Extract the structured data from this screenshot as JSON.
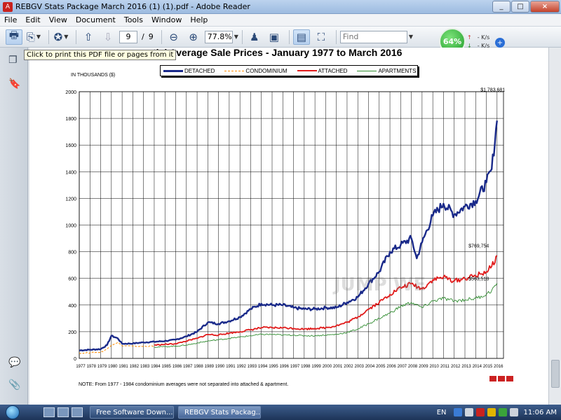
{
  "window": {
    "title": "REBGV Stats Package March 2016 (1) (1).pdf - Adobe Reader",
    "app_icon": "adobe-reader-icon",
    "controls": [
      "minimize",
      "maximize",
      "close"
    ]
  },
  "menu": [
    "File",
    "Edit",
    "View",
    "Document",
    "Tools",
    "Window",
    "Help"
  ],
  "toolbar": {
    "page_current": "9",
    "page_separator": "/",
    "page_total": "9",
    "zoom": "77.8%",
    "find_placeholder": "Find",
    "tooltip": "Click to print this PDF file or pages from it"
  },
  "speed_meter": {
    "percent": "64%",
    "up": "- K/s",
    "down": "- K/s"
  },
  "document": {
    "title": "...ential Average Sale Prices  -  January 1977 to March 2016",
    "ylabel": "IN THOUSANDS ($)",
    "note": "NOTE:  From 1977 - 1984 condominium averages were not separated into attached & apartment.",
    "watermark": "JUMP WE"
  },
  "chart_data": {
    "type": "line",
    "title": "Residential Average Sale Prices  -  January 1977 to March 2016",
    "ylabel": "IN THOUSANDS ($)",
    "ylim": [
      0,
      2000
    ],
    "yticks": [
      "0",
      "200",
      "400",
      "600",
      "800",
      "1000",
      "1200",
      "1400",
      "1600",
      "1800",
      "2000"
    ],
    "xticks": [
      "1977",
      "1978",
      "1979",
      "1980",
      "1981",
      "1982",
      "1983",
      "1984",
      "1985",
      "1986",
      "1987",
      "1988",
      "1989",
      "1990",
      "1991",
      "1992",
      "1993",
      "1994",
      "1995",
      "1996",
      "1997",
      "1998",
      "1999",
      "2000",
      "2001",
      "2002",
      "2003",
      "2004",
      "2005",
      "2006",
      "2007",
      "2008",
      "2009",
      "2010",
      "2011",
      "2012",
      "2013",
      "2014",
      "2015",
      "2016"
    ],
    "grid": true,
    "legend_position": "top",
    "series": [
      {
        "name": "DETACHED",
        "color": "#1a2a8a",
        "style": "solid",
        "x": [
          1977,
          1978,
          1979,
          1979.6,
          1980,
          1980.6,
          1981,
          1982,
          1983,
          1984,
          1985,
          1986,
          1987,
          1988,
          1989,
          1990,
          1991,
          1992,
          1993,
          1994,
          1995,
          1996,
          1997,
          1998,
          1999,
          2000,
          2001,
          2002,
          2003,
          2004,
          2005,
          2006,
          2007,
          2008,
          2008.5,
          2009,
          2010,
          2011,
          2012,
          2013,
          2014,
          2015,
          2015.5,
          2016
        ],
        "y": [
          60,
          65,
          70,
          100,
          170,
          150,
          110,
          112,
          120,
          125,
          130,
          140,
          165,
          200,
          270,
          260,
          280,
          310,
          370,
          410,
          400,
          400,
          380,
          370,
          370,
          380,
          380,
          420,
          460,
          560,
          650,
          800,
          850,
          900,
          750,
          870,
          1070,
          1160,
          1080,
          1140,
          1180,
          1320,
          1420,
          1783
        ]
      },
      {
        "name": "CONDOMINIUM",
        "color": "#ff8c00",
        "style": "dashed",
        "x": [
          1977,
          1978,
          1979,
          1979.6,
          1980,
          1980.6,
          1981,
          1982,
          1983,
          1984
        ],
        "y": [
          40,
          42,
          46,
          70,
          100,
          120,
          95,
          92,
          90,
          92
        ]
      },
      {
        "name": "ATTACHED",
        "color": "#e11b1b",
        "style": "solid",
        "x": [
          1984,
          1985,
          1986,
          1987,
          1988,
          1989,
          1990,
          1991,
          1992,
          1993,
          1994,
          1995,
          1996,
          1997,
          1998,
          1999,
          2000,
          2001,
          2002,
          2003,
          2004,
          2005,
          2006,
          2007,
          2008,
          2009,
          2010,
          2011,
          2012,
          2013,
          2014,
          2015,
          2015.5,
          2016
        ],
        "y": [
          100,
          105,
          110,
          130,
          150,
          180,
          175,
          190,
          200,
          215,
          230,
          230,
          230,
          225,
          220,
          225,
          230,
          245,
          270,
          310,
          370,
          420,
          480,
          530,
          560,
          520,
          590,
          610,
          580,
          600,
          620,
          650,
          690,
          770
        ]
      },
      {
        "name": "APARTMENTS",
        "color": "#2e8b2e",
        "style": "solid",
        "x": [
          1984,
          1985,
          1986,
          1987,
          1988,
          1989,
          1990,
          1991,
          1992,
          1993,
          1994,
          1995,
          1996,
          1997,
          1998,
          1999,
          2000,
          2001,
          2002,
          2003,
          2004,
          2005,
          2006,
          2007,
          2008,
          2009,
          2010,
          2011,
          2012,
          2013,
          2014,
          2015,
          2015.5,
          2016
        ],
        "y": [
          85,
          88,
          92,
          100,
          115,
          130,
          140,
          150,
          160,
          170,
          180,
          180,
          175,
          175,
          170,
          170,
          175,
          180,
          195,
          220,
          260,
          300,
          340,
          390,
          420,
          380,
          430,
          450,
          430,
          440,
          450,
          480,
          510,
          564
        ]
      }
    ],
    "annotations": [
      {
        "text": "$1,783,681",
        "x": 2015.6,
        "y": 1783
      },
      {
        "text": "$769,754",
        "x": 2015.6,
        "y": 770
      },
      {
        "text": "$563,518",
        "x": 2015.6,
        "y": 564
      }
    ]
  },
  "taskbar": {
    "tasks": [
      "Free Software Down...",
      "REBGV Stats Packag..."
    ],
    "language": "EN",
    "clock": "11:06 AM"
  }
}
